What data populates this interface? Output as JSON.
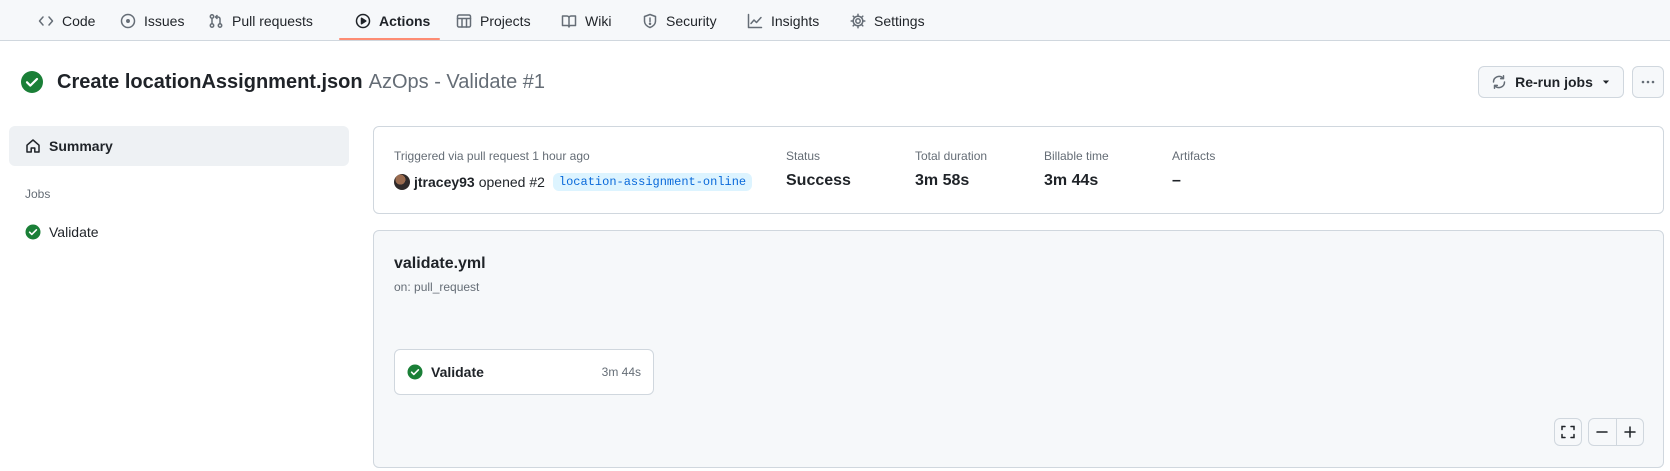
{
  "nav": {
    "tabs": [
      {
        "label": "Code",
        "icon": "code-icon"
      },
      {
        "label": "Issues",
        "icon": "issue-icon"
      },
      {
        "label": "Pull requests",
        "icon": "pull-request-icon"
      },
      {
        "label": "Actions",
        "icon": "play-icon",
        "active": true
      },
      {
        "label": "Projects",
        "icon": "table-icon"
      },
      {
        "label": "Wiki",
        "icon": "book-icon"
      },
      {
        "label": "Security",
        "icon": "shield-icon"
      },
      {
        "label": "Insights",
        "icon": "graph-icon"
      },
      {
        "label": "Settings",
        "icon": "gear-icon"
      }
    ]
  },
  "header": {
    "title": "Create locationAssignment.json",
    "subtitle": "AzOps - Validate #1",
    "rerun_label": "Re-run jobs"
  },
  "sidebar": {
    "summary_label": "Summary",
    "jobs_heading": "Jobs",
    "jobs": [
      {
        "label": "Validate",
        "status": "success"
      }
    ]
  },
  "summary": {
    "trigger_text": "Triggered via pull request 1 hour ago",
    "user": "jtracey93",
    "action_text": "opened #2",
    "branch": "location-assignment-online",
    "status_label": "Status",
    "status_value": "Success",
    "duration_label": "Total duration",
    "duration_value": "3m 58s",
    "billable_label": "Billable time",
    "billable_value": "3m 44s",
    "artifacts_label": "Artifacts",
    "artifacts_value": "–"
  },
  "workflow": {
    "name": "validate.yml",
    "trigger": "on: pull_request",
    "job": {
      "name": "Validate",
      "duration": "3m 44s"
    }
  },
  "colors": {
    "success": "#1a7f37",
    "accent_underline": "#fd8c73",
    "link": "#0969da"
  }
}
